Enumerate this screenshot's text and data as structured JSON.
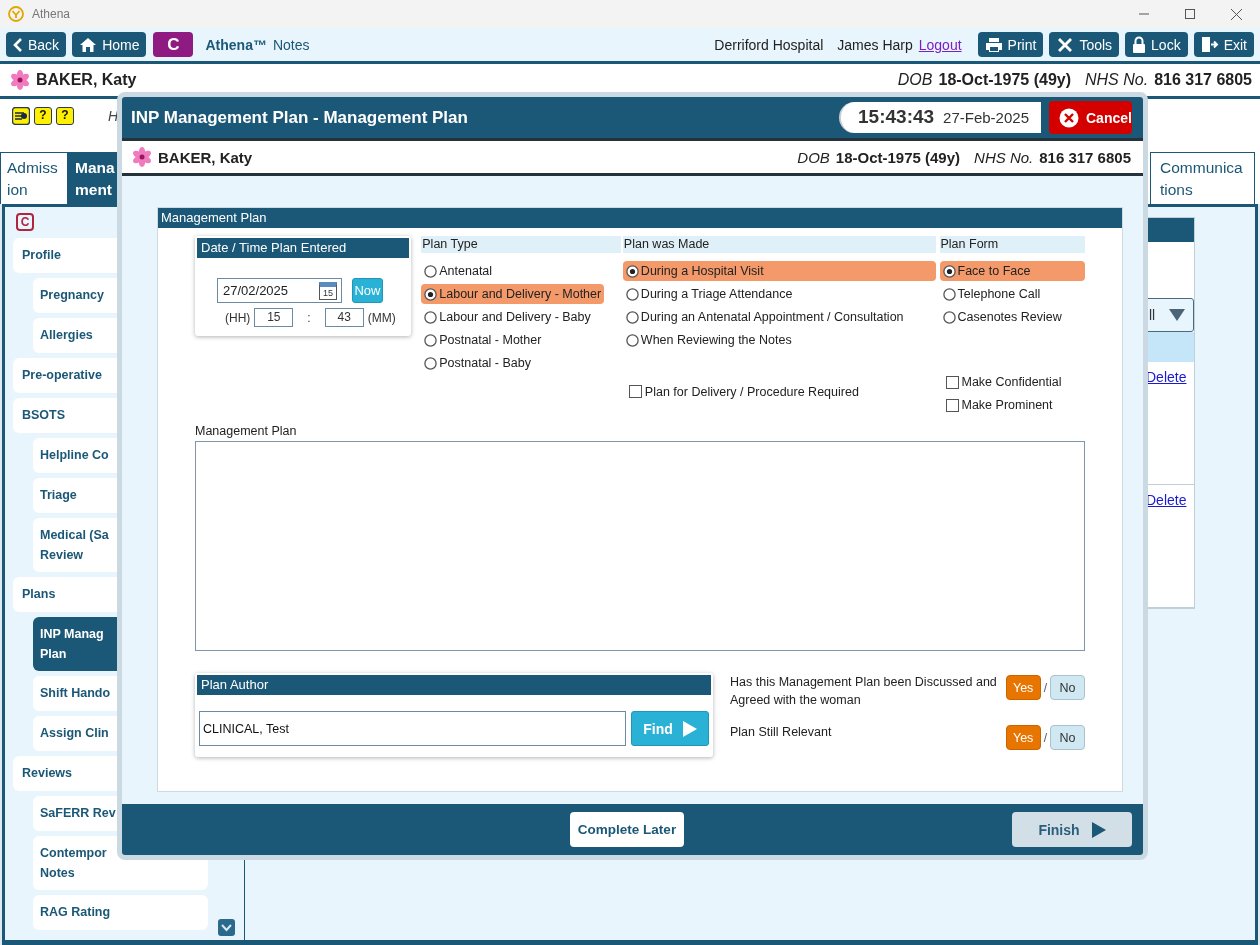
{
  "window": {
    "title": "Athena"
  },
  "toolbar": {
    "left_buttons": [
      {
        "label": "Back"
      },
      {
        "label": "Home"
      }
    ],
    "badge": "C",
    "app_name": "Athena™",
    "app_module": "Notes",
    "hospital": "Derriford Hospital",
    "user": "James Harp",
    "logout": "Logout",
    "right_buttons": [
      {
        "label": "Print"
      },
      {
        "label": "Tools"
      },
      {
        "label": "Lock"
      },
      {
        "label": "Exit"
      }
    ]
  },
  "patient": {
    "name": "BAKER, Katy",
    "dob_label": "DOB",
    "dob": "18-Oct-1975 (49y)",
    "nhs_label": "NHS No.",
    "nhs": "816 317 6805"
  },
  "alert_row": {
    "badges": [
      "?",
      "?"
    ],
    "text": "H"
  },
  "tabs": [
    {
      "label": "Admiss\nion",
      "selected": false
    },
    {
      "label": "Mana\nment",
      "selected": true
    },
    {
      "label": "Communica\ntions",
      "selected": false
    }
  ],
  "sidebar": {
    "badge": "C",
    "items": [
      {
        "label": "Profile",
        "selected": false,
        "children": [
          {
            "label": "Pregnancy",
            "selected": false
          },
          {
            "label": "Allergies",
            "selected": false
          }
        ]
      },
      {
        "label": "Pre-operative",
        "selected": false
      },
      {
        "label": "BSOTS",
        "selected": false,
        "children": [
          {
            "label": "Helpline Co",
            "selected": false
          },
          {
            "label": "Triage",
            "selected": false
          },
          {
            "label": "Medical (Sa\nReview",
            "selected": false
          }
        ]
      },
      {
        "label": "Plans",
        "selected": false,
        "children": [
          {
            "label": "INP Manag\nPlan",
            "selected": true
          },
          {
            "label": "Shift Hando",
            "selected": false
          },
          {
            "label": "Assign Clin",
            "selected": false
          }
        ]
      },
      {
        "label": "Reviews",
        "selected": false,
        "children": [
          {
            "label": "SaFERR Rev",
            "selected": false
          },
          {
            "label": "Contempor\nNotes",
            "selected": false
          },
          {
            "label": "RAG Rating",
            "selected": false
          }
        ]
      }
    ]
  },
  "background_panel": {
    "filter": "ll",
    "links": [
      "Delete",
      "Delete"
    ]
  },
  "dialog": {
    "title": "INP Management Plan - Management Plan",
    "time": "15:43:43",
    "date": "27-Feb-2025",
    "cancel": "Cancel",
    "patient": {
      "name": "BAKER, Katy",
      "dob_label": "DOB",
      "dob": "18-Oct-1975 (49y)",
      "nhs_label": "NHS No.",
      "nhs": "816 317 6805"
    },
    "section_title": "Management Plan",
    "date_entry": {
      "title": "Date / Time Plan Entered",
      "date": "27/02/2025",
      "calendar_day": "15",
      "now": "Now",
      "hh_label": "(HH)",
      "hours": "15",
      "separator": ":",
      "minutes": "43",
      "mm_label": "(MM)"
    },
    "radio_groups": [
      {
        "title": "Plan Type",
        "options": [
          {
            "label": "Antenatal",
            "selected": false
          },
          {
            "label": "Labour and Delivery - Mother",
            "selected": true
          },
          {
            "label": "Labour and Delivery - Baby",
            "selected": false
          },
          {
            "label": "Postnatal - Mother",
            "selected": false
          },
          {
            "label": "Postnatal - Baby",
            "selected": false
          }
        ]
      },
      {
        "title": "Plan was Made",
        "options": [
          {
            "label": "During a Hospital Visit",
            "selected": true
          },
          {
            "label": "During a Triage Attendance",
            "selected": false
          },
          {
            "label": "During an Antenatal Appointment / Consultation",
            "selected": false
          },
          {
            "label": "When Reviewing the Notes",
            "selected": false
          }
        ],
        "checks": [
          {
            "label": "Plan for Delivery / Procedure Required",
            "checked": false
          }
        ]
      },
      {
        "title": "Plan Form",
        "options": [
          {
            "label": "Face to Face",
            "selected": true
          },
          {
            "label": "Telephone Call",
            "selected": false
          },
          {
            "label": "Casenotes Review",
            "selected": false
          }
        ],
        "checks": [
          {
            "label": "Make Confidential",
            "checked": false
          },
          {
            "label": "Make Prominent",
            "checked": false
          }
        ]
      }
    ],
    "notes": {
      "label": "Management Plan"
    },
    "author": {
      "title": "Plan Author",
      "value": "CLINICAL, Test",
      "find": "Find"
    },
    "questions": [
      {
        "text": "Has this Management Plan been Discussed and Agreed with the woman",
        "separator": "/",
        "options": [
          {
            "label": "Yes",
            "selected": true
          },
          {
            "label": "No",
            "selected": false
          }
        ]
      },
      {
        "text": "Plan Still Relevant",
        "separator": "/",
        "options": [
          {
            "label": "Yes",
            "selected": true
          },
          {
            "label": "No",
            "selected": false
          }
        ]
      }
    ],
    "footer": {
      "complete_later": "Complete Later",
      "finish": "Finish",
      "finish_disabled": true
    }
  }
}
